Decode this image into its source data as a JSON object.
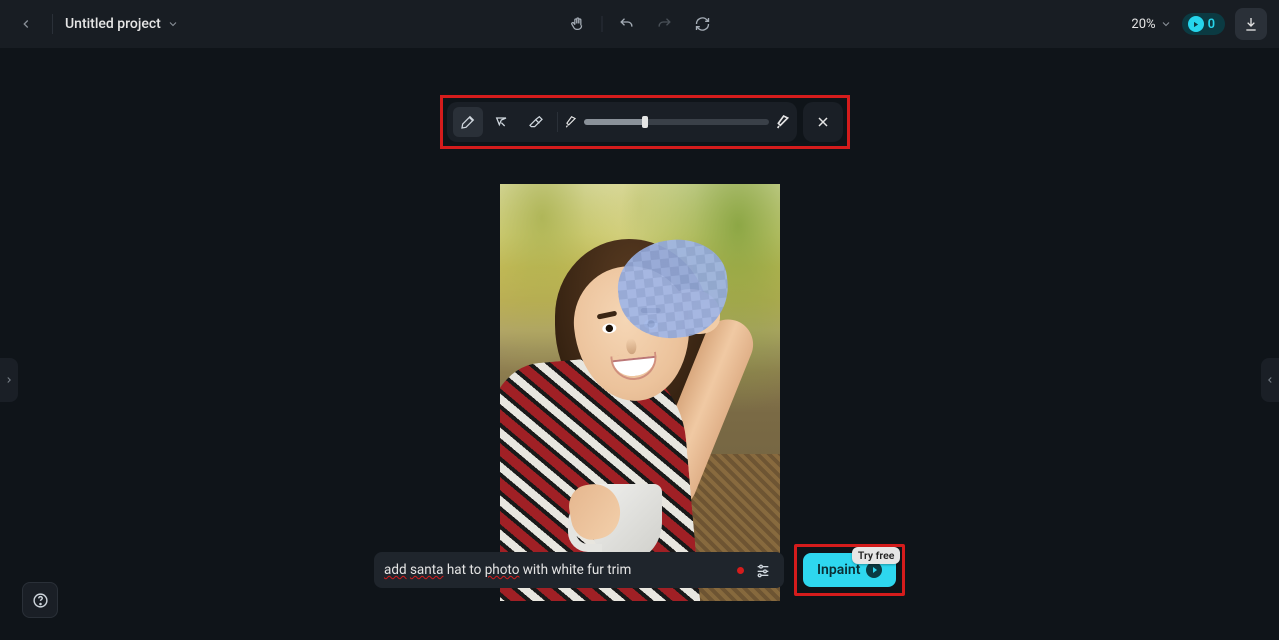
{
  "header": {
    "project_title": "Untitled project",
    "zoom": "20%",
    "credits": "0"
  },
  "brush_toolbar": {
    "slider_percent": 33
  },
  "prompt": {
    "word1": "add",
    "word2": "santa",
    "middle": " hat to ",
    "word3": "photo",
    "rest": " with white fur trim"
  },
  "inpaint": {
    "label": "Inpaint",
    "try_free": "Try free"
  }
}
